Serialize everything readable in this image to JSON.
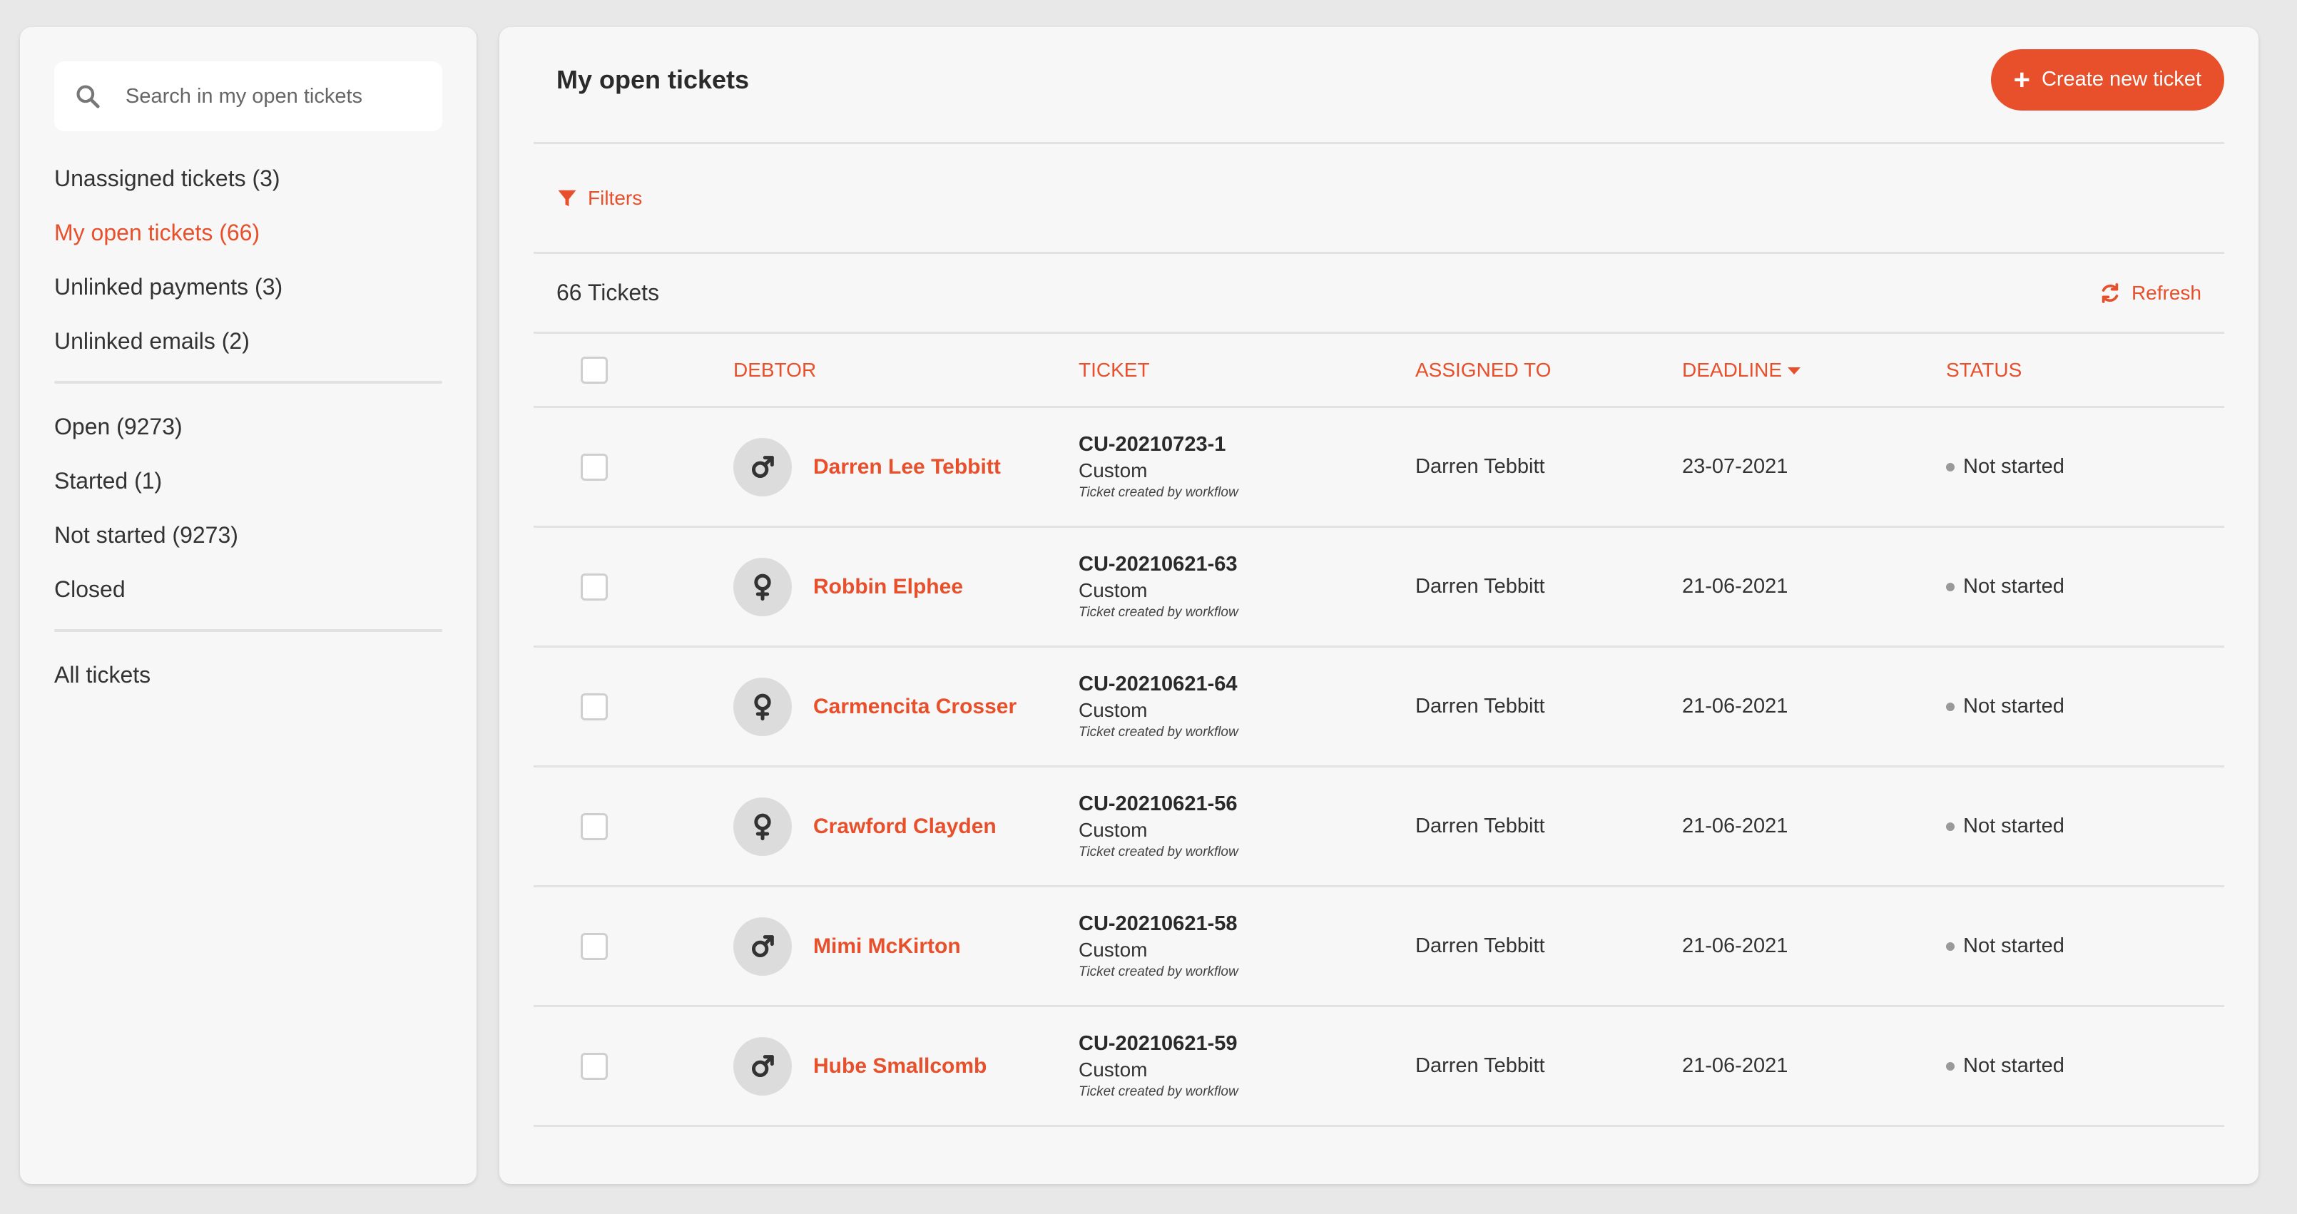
{
  "colors": {
    "accent": "#e8502c",
    "background": "#e8e8e8",
    "panel": "#f7f7f7"
  },
  "sidebar": {
    "search_placeholder": "Search in my open tickets",
    "group1": [
      {
        "label": "Unassigned tickets (3)",
        "active": false
      },
      {
        "label": "My open tickets (66)",
        "active": true
      },
      {
        "label": "Unlinked payments (3)",
        "active": false
      },
      {
        "label": "Unlinked emails (2)",
        "active": false
      }
    ],
    "group2": [
      {
        "label": "Open (9273)"
      },
      {
        "label": "Started (1)"
      },
      {
        "label": "Not started (9273)"
      },
      {
        "label": "Closed"
      }
    ],
    "group3": [
      {
        "label": "All tickets"
      }
    ]
  },
  "header": {
    "title": "My open tickets",
    "create_button": "Create new ticket"
  },
  "filters_label": "Filters",
  "count_label": "66 Tickets",
  "refresh_label": "Refresh",
  "table": {
    "columns": {
      "debtor": "DEBTOR",
      "ticket": "TICKET",
      "assigned": "ASSIGNED TO",
      "deadline": "DEADLINE",
      "status": "STATUS"
    },
    "rows": [
      {
        "gender": "male",
        "debtor": "Darren Lee Tebbitt",
        "ticket_id": "CU-20210723-1",
        "ticket_type": "Custom",
        "ticket_note": "Ticket created by workflow",
        "assigned": "Darren Tebbitt",
        "deadline": "23-07-2021",
        "status": "Not started"
      },
      {
        "gender": "female",
        "debtor": "Robbin Elphee",
        "ticket_id": "CU-20210621-63",
        "ticket_type": "Custom",
        "ticket_note": "Ticket created by workflow",
        "assigned": "Darren Tebbitt",
        "deadline": "21-06-2021",
        "status": "Not started"
      },
      {
        "gender": "female",
        "debtor": "Carmencita Crosser",
        "ticket_id": "CU-20210621-64",
        "ticket_type": "Custom",
        "ticket_note": "Ticket created by workflow",
        "assigned": "Darren Tebbitt",
        "deadline": "21-06-2021",
        "status": "Not started"
      },
      {
        "gender": "female",
        "debtor": "Crawford Clayden",
        "ticket_id": "CU-20210621-56",
        "ticket_type": "Custom",
        "ticket_note": "Ticket created by workflow",
        "assigned": "Darren Tebbitt",
        "deadline": "21-06-2021",
        "status": "Not started"
      },
      {
        "gender": "male",
        "debtor": "Mimi McKirton",
        "ticket_id": "CU-20210621-58",
        "ticket_type": "Custom",
        "ticket_note": "Ticket created by workflow",
        "assigned": "Darren Tebbitt",
        "deadline": "21-06-2021",
        "status": "Not started"
      },
      {
        "gender": "male",
        "debtor": "Hube Smallcomb",
        "ticket_id": "CU-20210621-59",
        "ticket_type": "Custom",
        "ticket_note": "Ticket created by workflow",
        "assigned": "Darren Tebbitt",
        "deadline": "21-06-2021",
        "status": "Not started"
      }
    ]
  }
}
